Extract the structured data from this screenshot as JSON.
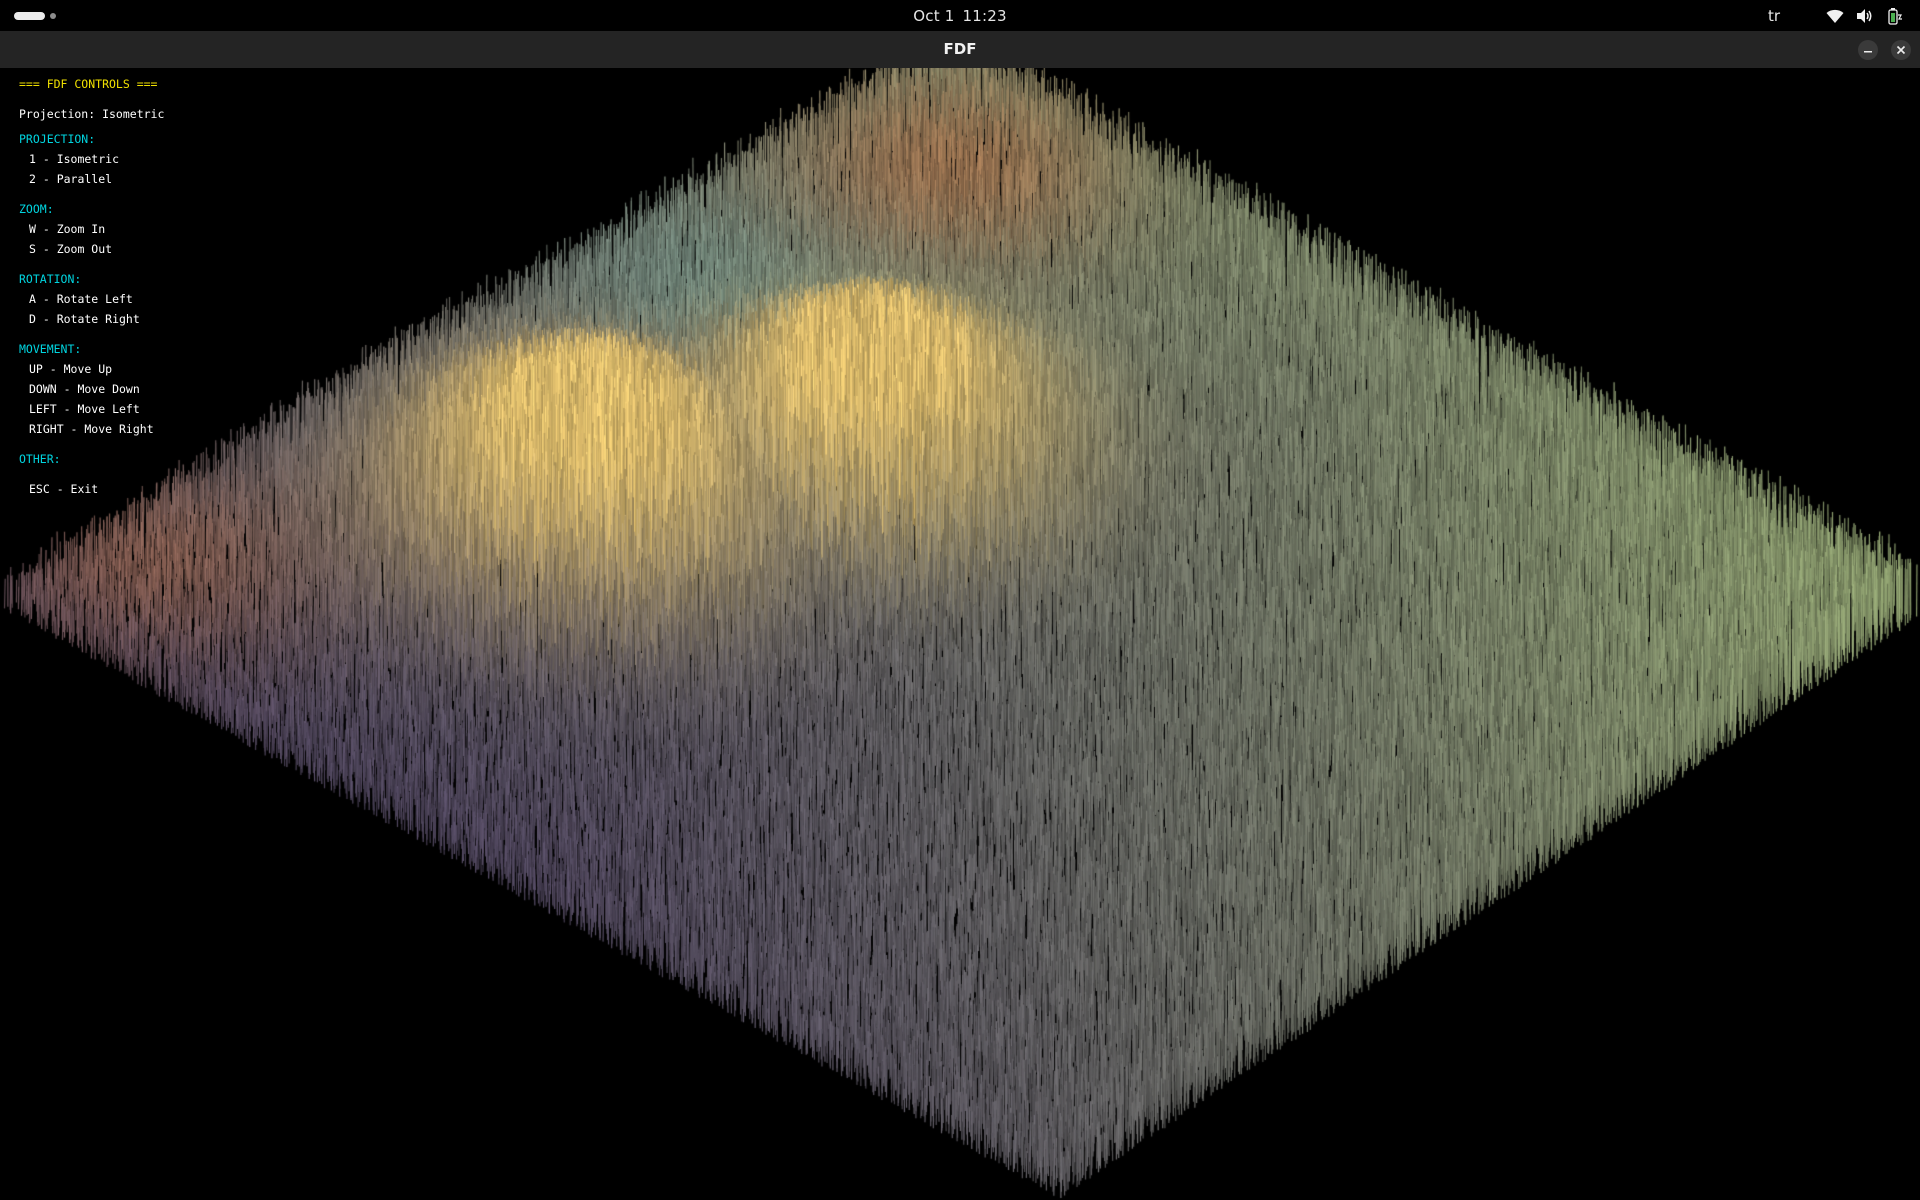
{
  "topbar": {
    "date": "Oct 1",
    "time": "11:23",
    "language": "tr",
    "icons": [
      "wifi-icon",
      "volume-icon",
      "battery-icon"
    ]
  },
  "window": {
    "title": "FDF",
    "minimize_icon": "minimize-icon",
    "close_icon": "close-icon"
  },
  "controls": {
    "header": "=== FDF CONTROLS ===",
    "projection_status": "Projection: Isometric",
    "projection_label": "PROJECTION:",
    "projection_items": [
      "1 - Isometric",
      "2 - Parallel"
    ],
    "zoom_label": "ZOOM:",
    "zoom_items": [
      "W - Zoom In",
      "S - Zoom Out"
    ],
    "rotation_label": "ROTATION:",
    "rotation_items": [
      "A - Rotate Left",
      "D - Rotate Right"
    ],
    "movement_label": "MOVEMENT:",
    "movement_items": [
      "UP - Move Up",
      "DOWN - Move Down",
      "LEFT - Move Left",
      "RIGHT - Move Right"
    ],
    "other_label": "OTHER:",
    "other_items": [
      "ESC - Exit"
    ]
  },
  "colors": {
    "header_yellow": "#f0e000",
    "section_cyan": "#00d5e0",
    "titlebar": "#242424"
  }
}
